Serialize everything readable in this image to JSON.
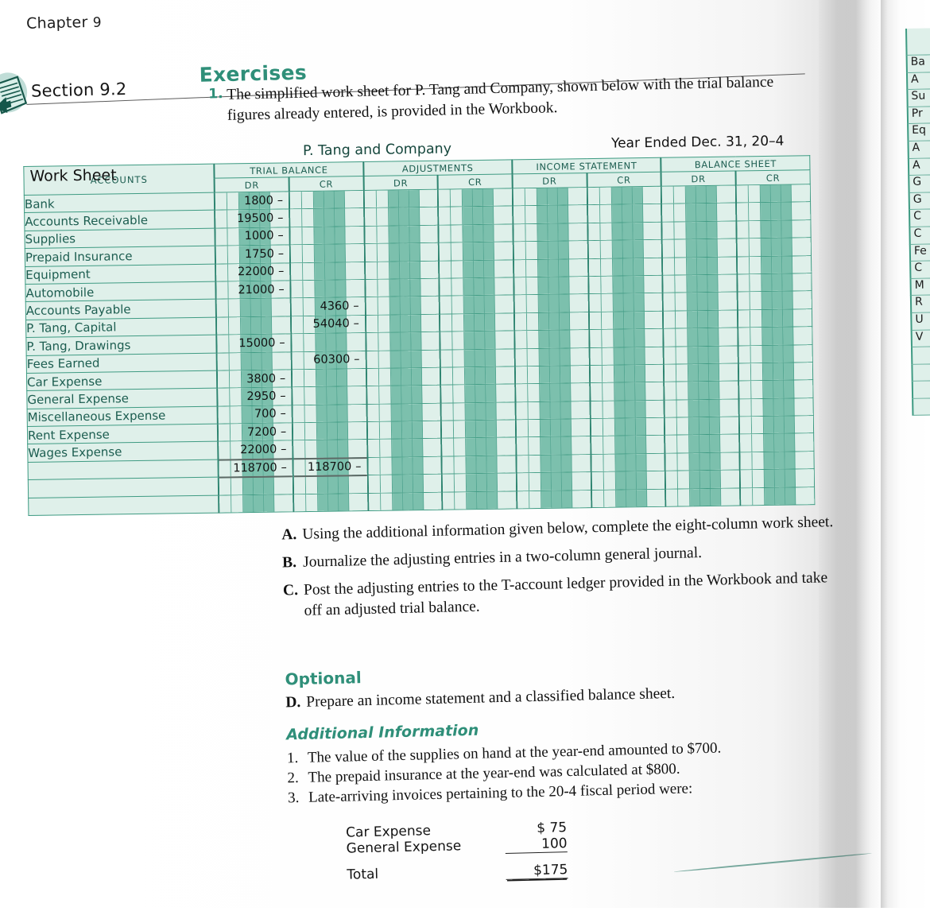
{
  "running_head": {
    "chapter_label": "Chapter",
    "chapter_number": "9"
  },
  "section": {
    "label": "Section 9.2",
    "exercises_title": "Exercises",
    "icon": "workbook-document-icon"
  },
  "question_1": {
    "number": "1.",
    "text": "The simplified work sheet for P. Tang and Company, shown below with the trial balance figures already entered, is provided in the Workbook."
  },
  "work_sheet": {
    "title": "Work Sheet",
    "company": "P. Tang and Company",
    "date": "Year Ended Dec. 31, 20–4",
    "accounts_header": "ACCOUNTS",
    "column_groups": [
      {
        "label": "TRIAL BALANCE",
        "dr": "DR",
        "cr": "CR"
      },
      {
        "label": "ADJUSTMENTS",
        "dr": "DR",
        "cr": "CR"
      },
      {
        "label": "INCOME STATEMENT",
        "dr": "DR",
        "cr": "CR"
      },
      {
        "label": "BALANCE SHEET",
        "dr": "DR",
        "cr": "CR"
      }
    ],
    "rows": [
      {
        "account": "Bank",
        "tb_dr": "1800",
        "tb_cr": ""
      },
      {
        "account": "Accounts Receivable",
        "tb_dr": "19500",
        "tb_cr": ""
      },
      {
        "account": "Supplies",
        "tb_dr": "1000",
        "tb_cr": ""
      },
      {
        "account": "Prepaid Insurance",
        "tb_dr": "1750",
        "tb_cr": ""
      },
      {
        "account": "Equipment",
        "tb_dr": "22000",
        "tb_cr": ""
      },
      {
        "account": "Automobile",
        "tb_dr": "21000",
        "tb_cr": ""
      },
      {
        "account": "Accounts Payable",
        "tb_dr": "",
        "tb_cr": "4360"
      },
      {
        "account": "P. Tang, Capital",
        "tb_dr": "",
        "tb_cr": "54040"
      },
      {
        "account": "P. Tang, Drawings",
        "tb_dr": "15000",
        "tb_cr": ""
      },
      {
        "account": "Fees Earned",
        "tb_dr": "",
        "tb_cr": "60300"
      },
      {
        "account": "Car Expense",
        "tb_dr": "3800",
        "tb_cr": ""
      },
      {
        "account": "General Expense",
        "tb_dr": "2950",
        "tb_cr": ""
      },
      {
        "account": "Miscellaneous Expense",
        "tb_dr": "700",
        "tb_cr": ""
      },
      {
        "account": "Rent Expense",
        "tb_dr": "7200",
        "tb_cr": ""
      },
      {
        "account": "Wages Expense",
        "tb_dr": "22000",
        "tb_cr": ""
      }
    ],
    "totals": {
      "account": "",
      "tb_dr": "118700",
      "tb_cr": "118700"
    },
    "dash": "–"
  },
  "tasks": [
    {
      "letter": "A.",
      "text": "Using the additional information given below, complete the eight-column work sheet."
    },
    {
      "letter": "B.",
      "text": "Journalize the adjusting entries in a two-column general journal."
    },
    {
      "letter": "C.",
      "text": "Post the adjusting entries to the T-account ledger provided in the Workbook and take off an adjusted trial balance."
    }
  ],
  "optional": {
    "heading": "Optional",
    "letter": "D.",
    "text": "Prepare an income statement and a classified balance sheet."
  },
  "additional_information": {
    "heading": "Additional Information",
    "items": [
      {
        "number": "1.",
        "text": "The value of the supplies on hand at the year-end amounted to $700."
      },
      {
        "number": "2.",
        "text": "The prepaid insurance at the year-end was calculated at $800."
      },
      {
        "number": "3.",
        "text": "Late-arriving invoices pertaining to the 20-4 fiscal period were:"
      }
    ],
    "invoice_table": {
      "rows": [
        {
          "label": "Car Expense",
          "amount": "$ 75"
        },
        {
          "label": "General Expense",
          "amount": "100"
        }
      ],
      "total_label": "Total",
      "total_amount": "$175"
    }
  },
  "next_page_sliver": {
    "rows": [
      "Ba",
      "A",
      "Su",
      "Pr",
      "Eq",
      "A",
      "A",
      "G",
      "G",
      "C",
      "C",
      "Fe",
      "C",
      "M",
      "R",
      "U",
      "V"
    ]
  },
  "colors": {
    "accent_teal": "#2f8f79",
    "grid_line": "#3f9b83",
    "cell_fill_light": "#dff0ea",
    "cell_fill_shaded": "#7cc0ad",
    "ink": "#111111"
  }
}
